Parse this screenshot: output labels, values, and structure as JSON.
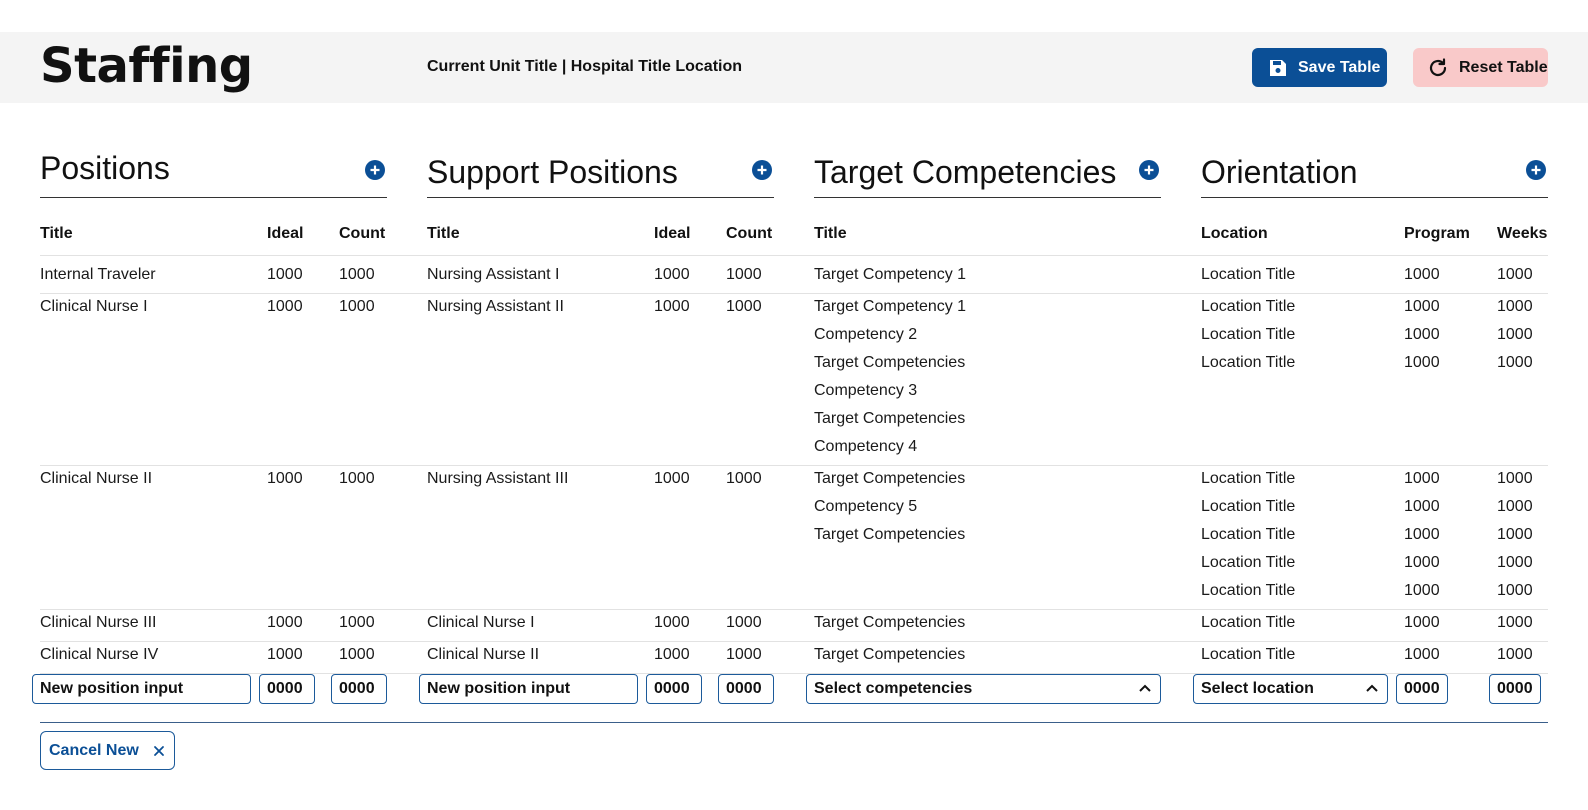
{
  "header": {
    "title": "Staffing",
    "unit": "Current Unit Title | Hospital Title Location",
    "save_label": "Save Table",
    "reset_label": "Reset Table"
  },
  "colors": {
    "primary": "#0b4f96",
    "reset_bg": "#f9c9c9",
    "header_bg": "#f4f4f4"
  },
  "positions": {
    "title": "Positions",
    "headers": [
      "Title",
      "Ideal",
      "Count"
    ],
    "rows": [
      [
        "Internal Traveler",
        "1000",
        "1000"
      ],
      [
        "Clinical Nurse I",
        "1000",
        "1000"
      ],
      [
        "Clinical Nurse II",
        "1000",
        "1000"
      ],
      [
        "Clinical Nurse III",
        "1000",
        "1000"
      ],
      [
        "Clinical Nurse IV",
        "1000",
        "1000"
      ]
    ],
    "new_title": "New position input",
    "new_ideal": "0000",
    "new_count": "0000"
  },
  "support": {
    "title": "Support Positions",
    "headers": [
      "Title",
      "Ideal",
      "Count"
    ],
    "rows": [
      [
        "Nursing Assistant I",
        "1000",
        "1000"
      ],
      [
        "Nursing Assistant II",
        "1000",
        "1000"
      ],
      [
        "Nursing Assistant III",
        "1000",
        "1000"
      ],
      [
        "Clinical Nurse I",
        "1000",
        "1000"
      ],
      [
        "Clinical Nurse II",
        "1000",
        "1000"
      ]
    ],
    "new_title": "New position input",
    "new_ideal": "0000",
    "new_count": "0000"
  },
  "competencies": {
    "title": "Target Competencies",
    "header": "Title",
    "row1": [
      "Target Competency 1"
    ],
    "row2": [
      "Target Competency 1",
      "Competency 2",
      "Target Competencies",
      "Competency 3",
      "Target Competencies",
      "Competency 4"
    ],
    "row3": [
      "Target Competencies",
      "Competency 5",
      "Target Competencies"
    ],
    "row4": [
      "Target Competencies"
    ],
    "row5": [
      "Target Competencies"
    ],
    "select_placeholder": "Select competencies"
  },
  "orientation": {
    "title": "Orientation",
    "headers": [
      "Location",
      "Program",
      "Weeks"
    ],
    "row1": [
      [
        "Location Title",
        "1000",
        "1000"
      ]
    ],
    "row2": [
      [
        "Location Title",
        "1000",
        "1000"
      ],
      [
        "Location Title",
        "1000",
        "1000"
      ],
      [
        "Location Title",
        "1000",
        "1000"
      ]
    ],
    "row3": [
      [
        "Location Title",
        "1000",
        "1000"
      ],
      [
        "Location Title",
        "1000",
        "1000"
      ],
      [
        "Location Title",
        "1000",
        "1000"
      ],
      [
        "Location Title",
        "1000",
        "1000"
      ],
      [
        "Location Title",
        "1000",
        "1000"
      ]
    ],
    "row4": [
      [
        "Location Title",
        "1000",
        "1000"
      ]
    ],
    "row5": [
      [
        "Location Title",
        "1000",
        "1000"
      ]
    ],
    "select_placeholder": "Select location",
    "new_program": "0000",
    "new_weeks": "0000"
  },
  "footer": {
    "cancel_label": "Cancel New"
  }
}
